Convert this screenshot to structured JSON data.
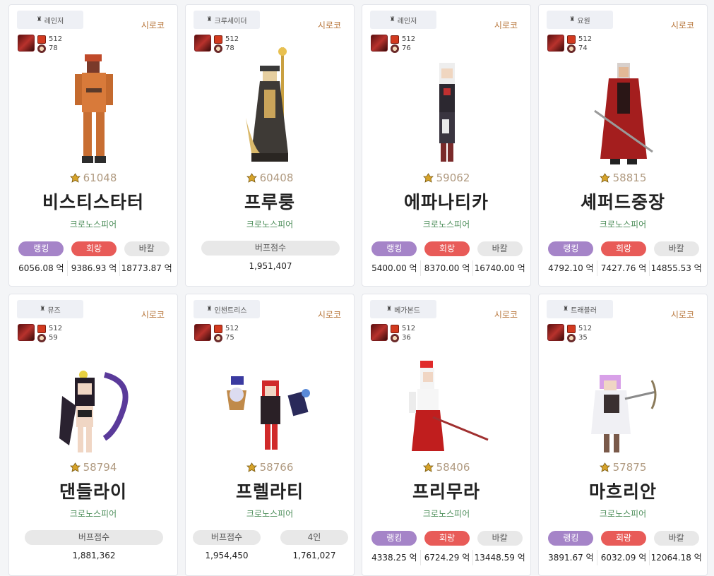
{
  "cards": [
    {
      "job": "레인저",
      "server": "시로코",
      "gear_level": "512",
      "pet_level": "78",
      "score": "61048",
      "name": "비스티스타터",
      "adventure": "크로노스피어",
      "stats": {
        "rank_label": "랭킹",
        "rank_value": "6056.08 억",
        "rate_label": "회랑",
        "rate_value": "9386.93 억",
        "raw_label": "바칼",
        "raw_value": "18773.87 억"
      }
    },
    {
      "job": "크루세이더",
      "server": "시로코",
      "gear_level": "512",
      "pet_level": "78",
      "score": "60408",
      "name": "프루룽",
      "adventure": "크로노스피어",
      "buff": {
        "label": "버프점수",
        "value": "1,951,407"
      }
    },
    {
      "job": "레인저",
      "server": "시로코",
      "gear_level": "512",
      "pet_level": "76",
      "score": "59062",
      "name": "에파나티카",
      "adventure": "크로노스피어",
      "stats": {
        "rank_label": "랭킹",
        "rank_value": "5400.00 억",
        "rate_label": "회랑",
        "rate_value": "8370.00 억",
        "raw_label": "바칼",
        "raw_value": "16740.00 억"
      }
    },
    {
      "job": "요원",
      "server": "시로코",
      "gear_level": "512",
      "pet_level": "74",
      "score": "58815",
      "name": "셰퍼드중장",
      "adventure": "크로노스피어",
      "stats": {
        "rank_label": "랭킹",
        "rank_value": "4792.10 억",
        "rate_label": "회랑",
        "rate_value": "7427.76 억",
        "raw_label": "바칼",
        "raw_value": "14855.53 억"
      }
    },
    {
      "job": "뮤즈",
      "server": "시로코",
      "gear_level": "512",
      "pet_level": "59",
      "score": "58794",
      "name": "댄들라이",
      "adventure": "크로노스피어",
      "buff": {
        "label": "버프점수",
        "value": "1,881,362"
      }
    },
    {
      "job": "인챈트리스",
      "server": "시로코",
      "gear_level": "512",
      "pet_level": "75",
      "score": "58766",
      "name": "프렐라티",
      "adventure": "크로노스피어",
      "buff2": {
        "label_a": "버프점수",
        "value_a": "1,954,450",
        "label_b": "4인",
        "value_b": "1,761,027"
      }
    },
    {
      "job": "베가본드",
      "server": "시로코",
      "gear_level": "512",
      "pet_level": "36",
      "score": "58406",
      "name": "프리무라",
      "adventure": "크로노스피어",
      "stats": {
        "rank_label": "랭킹",
        "rank_value": "4338.25 억",
        "rate_label": "회랑",
        "rate_value": "6724.29 억",
        "raw_label": "바칼",
        "raw_value": "13448.59 억"
      }
    },
    {
      "job": "트래블러",
      "server": "시로코",
      "gear_level": "512",
      "pet_level": "35",
      "score": "57875",
      "name": "마흐리안",
      "adventure": "크로노스피어",
      "stats": {
        "rank_label": "랭킹",
        "rank_value": "3891.67 억",
        "rate_label": "회랑",
        "rate_value": "6032.09 억",
        "raw_label": "바칼",
        "raw_value": "12064.18 억"
      }
    }
  ],
  "colors": {
    "server": "#b8773c",
    "adventure": "#4f8f5c",
    "rank": "#a584c8",
    "rate": "#e85b58",
    "raw": "#e8e8e8"
  }
}
